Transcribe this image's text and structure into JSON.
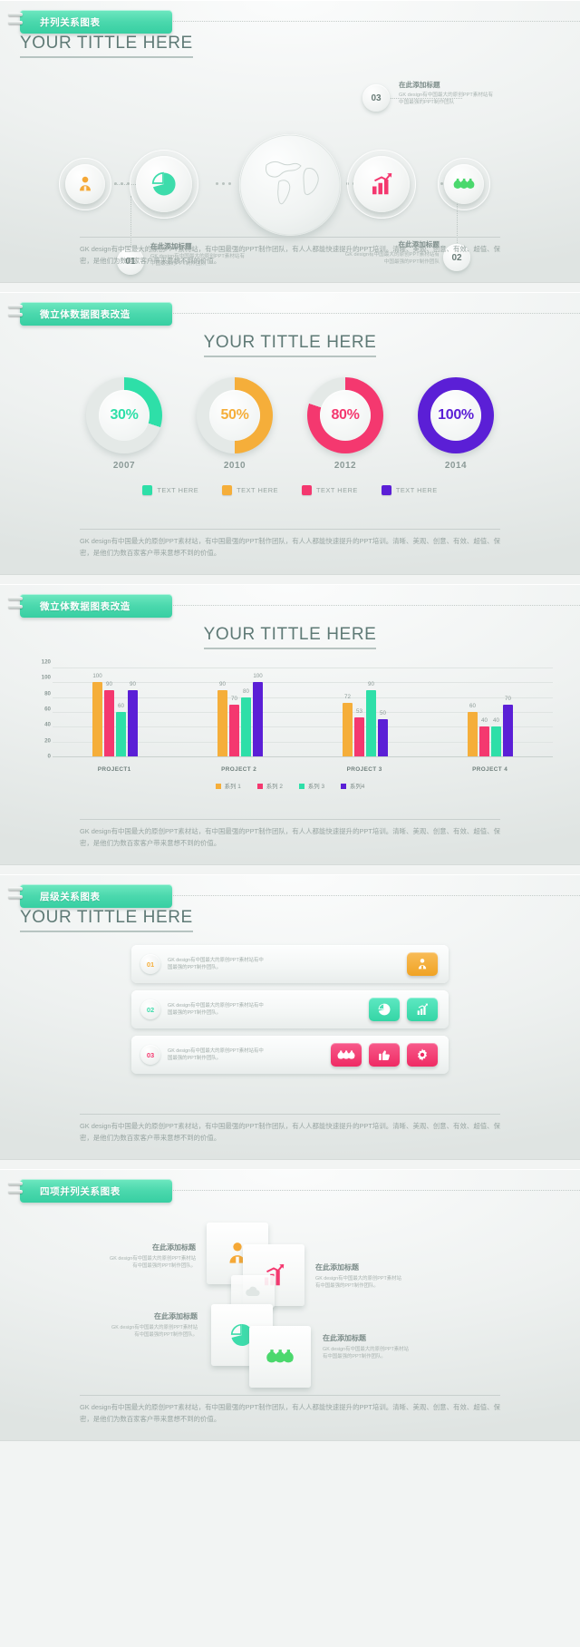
{
  "common": {
    "heading": "YOUR TITTLE HERE",
    "footer_paragraph": "GK design有中国最大的原创PPT素材站，有中国最强的PPT制作团队，有人人都能快速提升的PPT培训。清晰、美观、创意、有效、超值、保密，是他们为数百家客户带来意想不到的价值。"
  },
  "slide1": {
    "tab_label": "并列关系图表",
    "heading": "YOUR TITTLE HERE",
    "nodes": [
      {
        "icon": "user-icon",
        "color": "#f5a836"
      },
      {
        "icon": "pie-chart-icon",
        "color": "#3ddcab"
      },
      {
        "icon": "globe-icon",
        "color": "#d9e0de"
      },
      {
        "icon": "bar-growth-icon",
        "color": "#f4386f"
      },
      {
        "icon": "money-bags-icon",
        "color": "#4bd86d"
      }
    ],
    "callouts": [
      {
        "number": "01",
        "title": "在此添加标题",
        "body": "GK design有中国最大的原创PPT素材站有中国最强的PPT制作团队"
      },
      {
        "number": "02",
        "title": "在此添加标题",
        "body": "GK design有中国最大的原创PPT素材站有中国最强的PPT制作团队"
      },
      {
        "number": "03",
        "title": "在此添加标题",
        "body": "GK design有中国最大的原创PPT素材站有中国最强的PPT制作团队"
      }
    ],
    "footer_paragraph": "GK design有中国最大的原创PPT素材站，有中国最强的PPT制作团队，有人人都能快速提升的PPT培训。清晰、美观、创意、有效、超值、保密，是他们为数百家客户带来意想不到的价值。"
  },
  "slide2": {
    "tab_label": "微立体数据图表改造",
    "heading": "YOUR TITTLE HERE",
    "footer_paragraph": "GK design有中国最大的原创PPT素材站，有中国最强的PPT制作团队，有人人都能快速提升的PPT培训。清晰、美观、创意、有效、超值、保密，是他们为数百家客户带来意想不到的价值。",
    "chart_data": {
      "type": "pie",
      "title": "YOUR TITTLE HERE",
      "categories": [
        "2007",
        "2010",
        "2012",
        "2014"
      ],
      "values": [
        30,
        50,
        80,
        100
      ],
      "value_labels": [
        "30%",
        "50%",
        "80%",
        "100%"
      ],
      "colors": [
        "#2edfa8",
        "#f5ae3a",
        "#f4386f",
        "#5b1fd6"
      ],
      "track_color": "#e4e9e7",
      "legend": [
        "TEXT HERE",
        "TEXT HERE",
        "TEXT HERE",
        "TEXT HERE"
      ],
      "legend_position": "bottom",
      "unit": "%"
    }
  },
  "slide3": {
    "tab_label": "微立体数据图表改造",
    "heading": "YOUR TITTLE HERE",
    "footer_paragraph": "GK design有中国最大的原创PPT素材站，有中国最强的PPT制作团队，有人人都能快速提升的PPT培训。清晰、美观、创意、有效、超值、保密，是他们为数百家客户带来意想不到的价值。",
    "chart_data": {
      "type": "bar",
      "title": "YOUR TITTLE HERE",
      "xlabel": "",
      "ylabel": "",
      "ylim": [
        0,
        120
      ],
      "yticks": [
        0,
        20,
        40,
        60,
        80,
        100,
        120
      ],
      "grid": true,
      "legend_position": "bottom",
      "categories": [
        "PROJECT1",
        "PROJECT 2",
        "PROJECT 3",
        "PROJECT 4"
      ],
      "series": [
        {
          "name": "系列 1",
          "color": "#f5ae3a",
          "values": [
            100,
            90,
            72,
            60
          ]
        },
        {
          "name": "系列 2",
          "color": "#f4386f",
          "values": [
            90,
            70,
            53,
            40
          ]
        },
        {
          "name": "系列 3",
          "color": "#2edfa8",
          "values": [
            60,
            80,
            90,
            40
          ]
        },
        {
          "name": "系列4",
          "color": "#5b1fd6",
          "values": [
            90,
            100,
            50,
            70
          ]
        }
      ]
    }
  },
  "slide4": {
    "tab_label": "层级关系图表",
    "heading": "YOUR TITTLE HERE",
    "footer_paragraph": "GK design有中国最大的原创PPT素材站，有中国最强的PPT制作团队，有人人都能快速提升的PPT培训。清晰、美观、创意、有效、超值、保密，是他们为数百家客户带来意想不到的价值。",
    "rows": [
      {
        "number": "01",
        "text": "GK design有中国最大的原创PPT素材站有中国最强的PPT制作团队。",
        "num_color": "#f5ae3a",
        "icons": [
          {
            "name": "user-icon",
            "color": "#f5ae3a"
          }
        ]
      },
      {
        "number": "02",
        "text": "GK design有中国最大的原创PPT素材站有中国最强的PPT制作团队。",
        "num_color": "#3ddcab",
        "icons": [
          {
            "name": "pie-chart-icon",
            "color": "#3ddcab"
          },
          {
            "name": "bar-growth-icon",
            "color": "#3ddcab"
          }
        ]
      },
      {
        "number": "03",
        "text": "GK design有中国最大的原创PPT素材站有中国最强的PPT制作团队。",
        "num_color": "#f4386f",
        "icons": [
          {
            "name": "money-bags-icon",
            "color": "#f4386f"
          },
          {
            "name": "thumbs-up-icon",
            "color": "#f4386f"
          },
          {
            "name": "gear-icon",
            "color": "#f4386f"
          }
        ]
      }
    ]
  },
  "slide5": {
    "tab_label": "四项并列关系图表",
    "footer_paragraph": "GK design有中国最大的原创PPT素材站，有中国最强的PPT制作团队，有人人都能快速提升的PPT培训。清晰、美观、创意、有效、超值、保密，是他们为数百家客户带来意想不到的价值。",
    "items": [
      {
        "title": "在此添加标题",
        "body": "GK design有中国最大的原创PPT素材站有中国最强的PPT制作团队。",
        "icon": "user-icon",
        "color": "#f5a836"
      },
      {
        "title": "在此添加标题",
        "body": "GK design有中国最大的原创PPT素材站有中国最强的PPT制作团队。",
        "icon": "bar-growth-icon",
        "color": "#f4386f"
      },
      {
        "title": "在此添加标题",
        "body": "GK design有中国最大的原创PPT素材站有中国最强的PPT制作团队。",
        "icon": "pie-chart-icon",
        "color": "#3ddcab"
      },
      {
        "title": "在此添加标题",
        "body": "GK design有中国最大的原创PPT素材站有中国最强的PPT制作团队。",
        "icon": "money-bags-icon",
        "color": "#4bd86d"
      }
    ]
  }
}
